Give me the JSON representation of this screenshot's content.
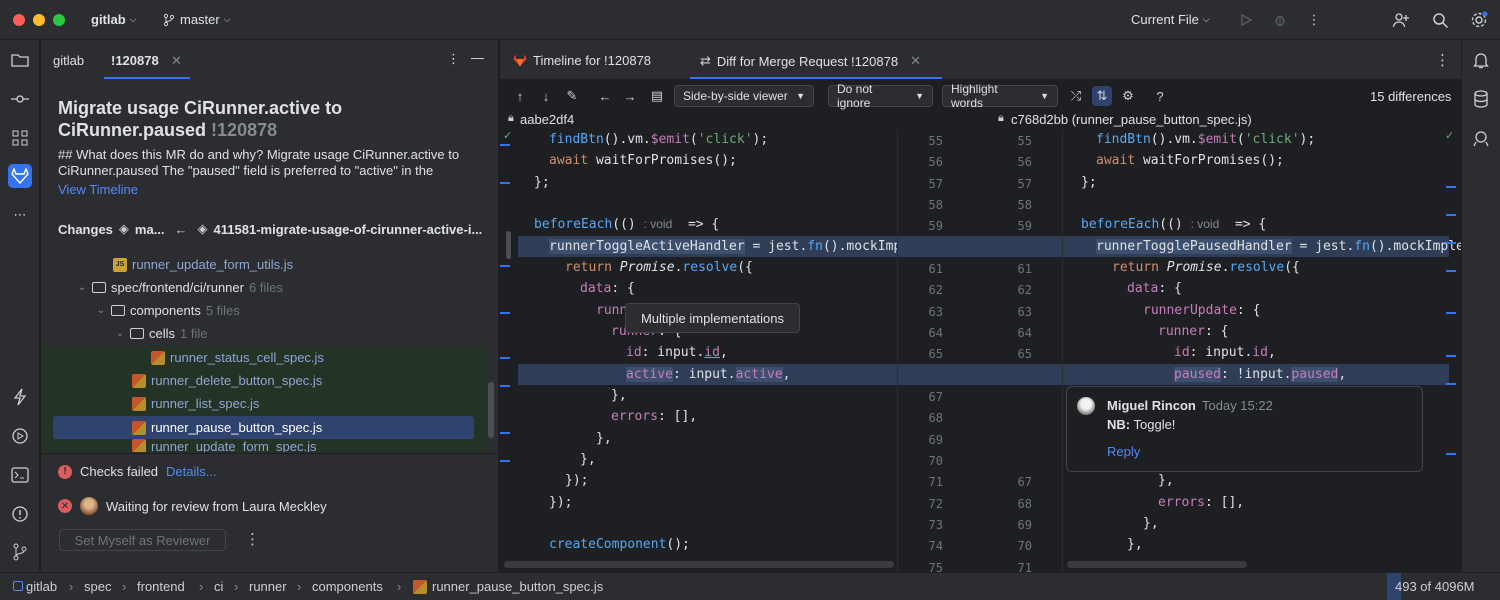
{
  "titlebar": {
    "project": "gitlab",
    "branch": "master",
    "run_config": "Current File"
  },
  "left_panel": {
    "tab_project": "gitlab",
    "tab_mr": "!120878",
    "mr_title": "Migrate usage CiRunner.active to CiRunner.paused",
    "mr_number": "!120878",
    "mr_description": "## What does this MR do and why? Migrate usage CiRunner.active to CiRunner.paused The \"paused\" field is preferred to \"active\" in the",
    "view_timeline": "View Timeline",
    "changes_label": "Changes",
    "target_branch": "ma...",
    "source_branch": "411581-migrate-usage-of-cirunner-active-i...",
    "tree": [
      {
        "name": "runner_update_form_utils.js",
        "count": ""
      },
      {
        "name": "spec/frontend/ci/runner",
        "count": "6 files"
      },
      {
        "name": "components",
        "count": "5 files"
      },
      {
        "name": "cells",
        "count": "1 file"
      },
      {
        "name": "runner_status_cell_spec.js",
        "count": ""
      },
      {
        "name": "runner_delete_button_spec.js",
        "count": ""
      },
      {
        "name": "runner_list_spec.js",
        "count": ""
      },
      {
        "name": "runner_pause_button_spec.js",
        "count": ""
      },
      {
        "name": "runner_update_form_spec.js",
        "count": ""
      }
    ],
    "checks_failed": "Checks failed",
    "details_link": "Details...",
    "waiting_review": "Waiting for review from Laura Meckley",
    "set_reviewer": "Set Myself as Reviewer"
  },
  "editor": {
    "tab_timeline": "Timeline for !120878",
    "tab_diff": "Diff for Merge Request !120878",
    "viewer_dd": "Side-by-side viewer",
    "ignore_dd": "Do not ignore",
    "highlight_dd": "Highlight words",
    "differences": "15 differences",
    "left_rev": "aabe2df4",
    "right_rev": "c768d2bb (runner_pause_button_spec.js)",
    "left_lines": [
      "findBtn().vm.$emit('click');",
      "await waitForPromises();",
      "};",
      "",
      "beforeEach(() ",
      "runnerToggleActiveHandler = jest.fn().mockImp",
      "return Promise.resolve({",
      "data: {",
      "runn",
      "runner: {",
      "id: input.id,",
      "active: input.active,",
      "},",
      "errors: [],",
      "},",
      "},",
      "});",
      "});",
      "",
      "createComponent();"
    ],
    "right_lines": [
      "findBtn().vm.$emit('click');",
      "await waitForPromises();",
      "};",
      "",
      "beforeEach(() ",
      "runnerTogglePausedHandler = jest.fn().mockImple",
      "return Promise.resolve({",
      "data: {",
      "runnerUpdate: {",
      "runner: {",
      "id: input.id,",
      "paused: !input.paused,",
      "},",
      "errors: [],",
      "},",
      "},"
    ],
    "inline_hint": ": void",
    "arrow": "=> {",
    "left_numbers": [
      "55",
      "56",
      "57",
      "58",
      "59",
      "",
      "61",
      "62",
      "63",
      "64",
      "65",
      "",
      "67",
      "68",
      "69",
      "70",
      "71",
      "72",
      "73",
      "74",
      "75"
    ],
    "right_numbers": [
      "55",
      "56",
      "57",
      "58",
      "59",
      "",
      "61",
      "62",
      "63",
      "64",
      "65",
      "",
      "",
      "",
      "",
      "",
      "67",
      "68",
      "69",
      "70",
      "71"
    ],
    "tooltip": "Multiple implementations",
    "comment": {
      "author": "Miguel Rincon",
      "time": "Today 15:22",
      "body_bold": "NB:",
      "body": "Toggle!",
      "reply": "Reply"
    }
  },
  "statusbar": {
    "breadcrumb": [
      "gitlab",
      "spec",
      "frontend",
      "ci",
      "runner",
      "components",
      "runner_pause_button_spec.js"
    ],
    "memory": "493 of 4096M"
  }
}
